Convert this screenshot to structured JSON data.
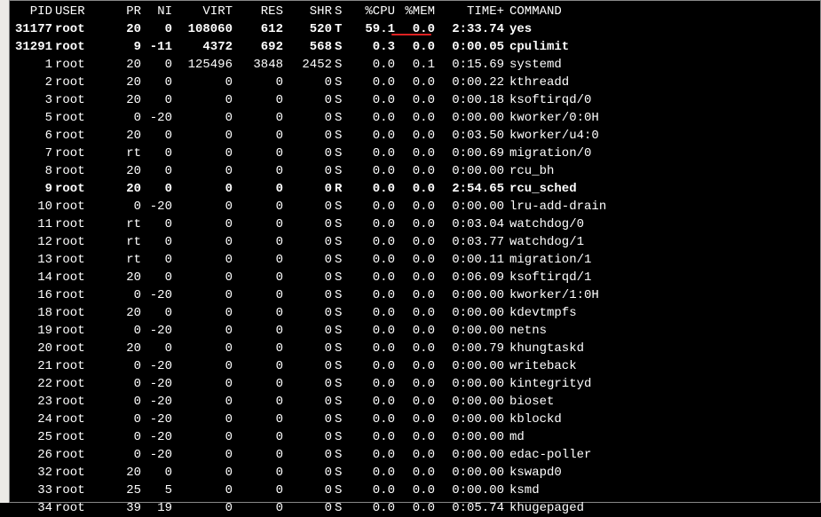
{
  "headers": {
    "pid": "PID",
    "user": "USER",
    "pr": "PR",
    "ni": "NI",
    "virt": "VIRT",
    "res": "RES",
    "shr": "SHR",
    "s": "S",
    "cpu": "%CPU",
    "mem": "%MEM",
    "time": "TIME+",
    "cmd": "COMMAND"
  },
  "rows": [
    {
      "pid": "31177",
      "user": "root",
      "pr": "20",
      "ni": "0",
      "virt": "108060",
      "res": "612",
      "shr": "520",
      "s": "T",
      "cpu": "59.1",
      "mem": "0.0",
      "time": "2:33.74",
      "cmd": "yes",
      "bold": true
    },
    {
      "pid": "31291",
      "user": "root",
      "pr": "9",
      "ni": "-11",
      "virt": "4372",
      "res": "692",
      "shr": "568",
      "s": "S",
      "cpu": "0.3",
      "mem": "0.0",
      "time": "0:00.05",
      "cmd": "cpulimit",
      "bold": true
    },
    {
      "pid": "1",
      "user": "root",
      "pr": "20",
      "ni": "0",
      "virt": "125496",
      "res": "3848",
      "shr": "2452",
      "s": "S",
      "cpu": "0.0",
      "mem": "0.1",
      "time": "0:15.69",
      "cmd": "systemd"
    },
    {
      "pid": "2",
      "user": "root",
      "pr": "20",
      "ni": "0",
      "virt": "0",
      "res": "0",
      "shr": "0",
      "s": "S",
      "cpu": "0.0",
      "mem": "0.0",
      "time": "0:00.22",
      "cmd": "kthreadd"
    },
    {
      "pid": "3",
      "user": "root",
      "pr": "20",
      "ni": "0",
      "virt": "0",
      "res": "0",
      "shr": "0",
      "s": "S",
      "cpu": "0.0",
      "mem": "0.0",
      "time": "0:00.18",
      "cmd": "ksoftirqd/0"
    },
    {
      "pid": "5",
      "user": "root",
      "pr": "0",
      "ni": "-20",
      "virt": "0",
      "res": "0",
      "shr": "0",
      "s": "S",
      "cpu": "0.0",
      "mem": "0.0",
      "time": "0:00.00",
      "cmd": "kworker/0:0H"
    },
    {
      "pid": "6",
      "user": "root",
      "pr": "20",
      "ni": "0",
      "virt": "0",
      "res": "0",
      "shr": "0",
      "s": "S",
      "cpu": "0.0",
      "mem": "0.0",
      "time": "0:03.50",
      "cmd": "kworker/u4:0"
    },
    {
      "pid": "7",
      "user": "root",
      "pr": "rt",
      "ni": "0",
      "virt": "0",
      "res": "0",
      "shr": "0",
      "s": "S",
      "cpu": "0.0",
      "mem": "0.0",
      "time": "0:00.69",
      "cmd": "migration/0"
    },
    {
      "pid": "8",
      "user": "root",
      "pr": "20",
      "ni": "0",
      "virt": "0",
      "res": "0",
      "shr": "0",
      "s": "S",
      "cpu": "0.0",
      "mem": "0.0",
      "time": "0:00.00",
      "cmd": "rcu_bh"
    },
    {
      "pid": "9",
      "user": "root",
      "pr": "20",
      "ni": "0",
      "virt": "0",
      "res": "0",
      "shr": "0",
      "s": "R",
      "cpu": "0.0",
      "mem": "0.0",
      "time": "2:54.65",
      "cmd": "rcu_sched",
      "bold": true
    },
    {
      "pid": "10",
      "user": "root",
      "pr": "0",
      "ni": "-20",
      "virt": "0",
      "res": "0",
      "shr": "0",
      "s": "S",
      "cpu": "0.0",
      "mem": "0.0",
      "time": "0:00.00",
      "cmd": "lru-add-drain"
    },
    {
      "pid": "11",
      "user": "root",
      "pr": "rt",
      "ni": "0",
      "virt": "0",
      "res": "0",
      "shr": "0",
      "s": "S",
      "cpu": "0.0",
      "mem": "0.0",
      "time": "0:03.04",
      "cmd": "watchdog/0"
    },
    {
      "pid": "12",
      "user": "root",
      "pr": "rt",
      "ni": "0",
      "virt": "0",
      "res": "0",
      "shr": "0",
      "s": "S",
      "cpu": "0.0",
      "mem": "0.0",
      "time": "0:03.77",
      "cmd": "watchdog/1"
    },
    {
      "pid": "13",
      "user": "root",
      "pr": "rt",
      "ni": "0",
      "virt": "0",
      "res": "0",
      "shr": "0",
      "s": "S",
      "cpu": "0.0",
      "mem": "0.0",
      "time": "0:00.11",
      "cmd": "migration/1"
    },
    {
      "pid": "14",
      "user": "root",
      "pr": "20",
      "ni": "0",
      "virt": "0",
      "res": "0",
      "shr": "0",
      "s": "S",
      "cpu": "0.0",
      "mem": "0.0",
      "time": "0:06.09",
      "cmd": "ksoftirqd/1"
    },
    {
      "pid": "16",
      "user": "root",
      "pr": "0",
      "ni": "-20",
      "virt": "0",
      "res": "0",
      "shr": "0",
      "s": "S",
      "cpu": "0.0",
      "mem": "0.0",
      "time": "0:00.00",
      "cmd": "kworker/1:0H"
    },
    {
      "pid": "18",
      "user": "root",
      "pr": "20",
      "ni": "0",
      "virt": "0",
      "res": "0",
      "shr": "0",
      "s": "S",
      "cpu": "0.0",
      "mem": "0.0",
      "time": "0:00.00",
      "cmd": "kdevtmpfs"
    },
    {
      "pid": "19",
      "user": "root",
      "pr": "0",
      "ni": "-20",
      "virt": "0",
      "res": "0",
      "shr": "0",
      "s": "S",
      "cpu": "0.0",
      "mem": "0.0",
      "time": "0:00.00",
      "cmd": "netns"
    },
    {
      "pid": "20",
      "user": "root",
      "pr": "20",
      "ni": "0",
      "virt": "0",
      "res": "0",
      "shr": "0",
      "s": "S",
      "cpu": "0.0",
      "mem": "0.0",
      "time": "0:00.79",
      "cmd": "khungtaskd"
    },
    {
      "pid": "21",
      "user": "root",
      "pr": "0",
      "ni": "-20",
      "virt": "0",
      "res": "0",
      "shr": "0",
      "s": "S",
      "cpu": "0.0",
      "mem": "0.0",
      "time": "0:00.00",
      "cmd": "writeback"
    },
    {
      "pid": "22",
      "user": "root",
      "pr": "0",
      "ni": "-20",
      "virt": "0",
      "res": "0",
      "shr": "0",
      "s": "S",
      "cpu": "0.0",
      "mem": "0.0",
      "time": "0:00.00",
      "cmd": "kintegrityd"
    },
    {
      "pid": "23",
      "user": "root",
      "pr": "0",
      "ni": "-20",
      "virt": "0",
      "res": "0",
      "shr": "0",
      "s": "S",
      "cpu": "0.0",
      "mem": "0.0",
      "time": "0:00.00",
      "cmd": "bioset"
    },
    {
      "pid": "24",
      "user": "root",
      "pr": "0",
      "ni": "-20",
      "virt": "0",
      "res": "0",
      "shr": "0",
      "s": "S",
      "cpu": "0.0",
      "mem": "0.0",
      "time": "0:00.00",
      "cmd": "kblockd"
    },
    {
      "pid": "25",
      "user": "root",
      "pr": "0",
      "ni": "-20",
      "virt": "0",
      "res": "0",
      "shr": "0",
      "s": "S",
      "cpu": "0.0",
      "mem": "0.0",
      "time": "0:00.00",
      "cmd": "md"
    },
    {
      "pid": "26",
      "user": "root",
      "pr": "0",
      "ni": "-20",
      "virt": "0",
      "res": "0",
      "shr": "0",
      "s": "S",
      "cpu": "0.0",
      "mem": "0.0",
      "time": "0:00.00",
      "cmd": "edac-poller"
    },
    {
      "pid": "32",
      "user": "root",
      "pr": "20",
      "ni": "0",
      "virt": "0",
      "res": "0",
      "shr": "0",
      "s": "S",
      "cpu": "0.0",
      "mem": "0.0",
      "time": "0:00.00",
      "cmd": "kswapd0"
    },
    {
      "pid": "33",
      "user": "root",
      "pr": "25",
      "ni": "5",
      "virt": "0",
      "res": "0",
      "shr": "0",
      "s": "S",
      "cpu": "0.0",
      "mem": "0.0",
      "time": "0:00.00",
      "cmd": "ksmd"
    },
    {
      "pid": "34",
      "user": "root",
      "pr": "39",
      "ni": "19",
      "virt": "0",
      "res": "0",
      "shr": "0",
      "s": "S",
      "cpu": "0.0",
      "mem": "0.0",
      "time": "0:05.74",
      "cmd": "khugepaged"
    }
  ]
}
